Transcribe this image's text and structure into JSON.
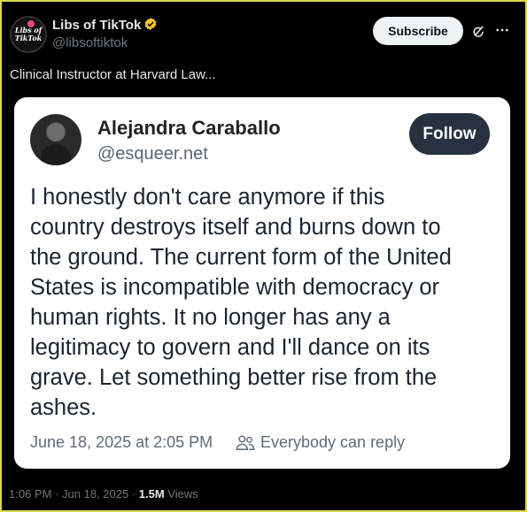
{
  "post": {
    "author_name": "Libs of TikTok",
    "author_handle": "@libsoftiktok",
    "avatar_text": "Libs of TikTok",
    "subscribe_label": "Subscribe",
    "text": "Clinical Instructor at Harvard Law...",
    "time": "1:06 PM",
    "date": "Jun 18, 2025",
    "separator": "·",
    "views_count": "1.5M",
    "views_label": "Views",
    "verified_color": "#f4c430"
  },
  "embed": {
    "name": "Alejandra Caraballo",
    "handle": "@esqueer.net",
    "follow_label": "Follow",
    "text_lines": [
      "I honestly don't care anymore if this",
      "country destroys itself and burns down to",
      "the ground. The current form of the United",
      "States is incompatible with democracy or",
      "human rights. It no longer has any a",
      "legitimacy to govern and I'll dance on its",
      "grave. Let something better rise from the",
      "ashes."
    ],
    "date": "June 18, 2025 at 2:05 PM",
    "reply_setting": "Everybody can reply"
  },
  "icons": {
    "verified": "verified-badge-icon",
    "grok": "grok-icon",
    "more": "more-icon",
    "people": "people-icon"
  }
}
